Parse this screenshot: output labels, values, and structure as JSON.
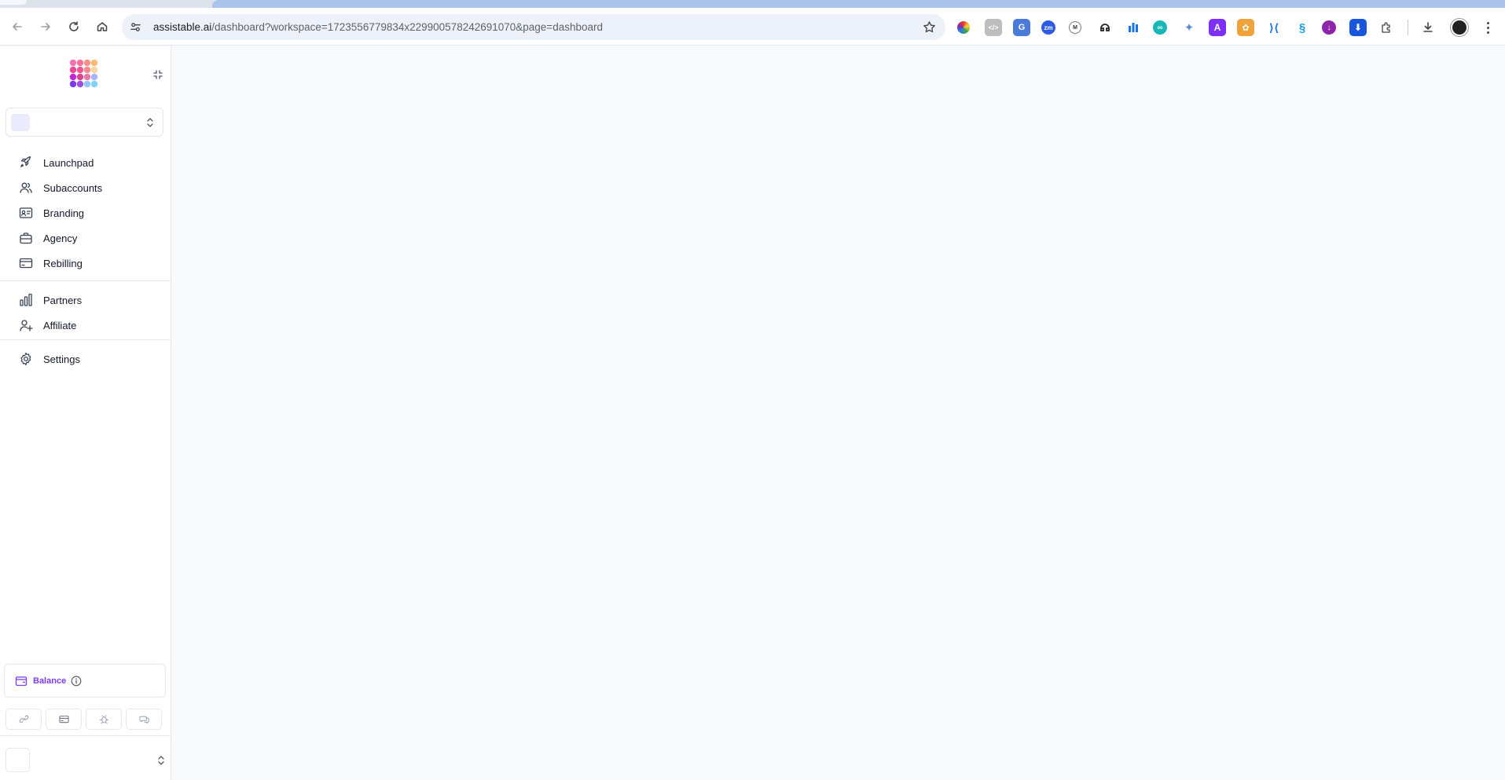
{
  "browser": {
    "url_host": "assistable.ai",
    "url_path": "/dashboard?workspace=1723556779834x229900578242691070&page=dashboard"
  },
  "sidebar": {
    "primary_items": [
      {
        "label": "Launchpad",
        "icon": "rocket-icon"
      },
      {
        "label": "Subaccounts",
        "icon": "users-icon"
      },
      {
        "label": "Branding",
        "icon": "id-card-icon"
      },
      {
        "label": "Agency",
        "icon": "briefcase-icon"
      },
      {
        "label": "Rebilling",
        "icon": "credit-card-icon"
      }
    ],
    "secondary_items": [
      {
        "label": "Partners",
        "icon": "bar-chart-icon"
      },
      {
        "label": "Affiliate",
        "icon": "user-plus-icon"
      }
    ],
    "settings_item": {
      "label": "Settings",
      "icon": "gear-icon"
    },
    "balance": {
      "label": "Balance"
    }
  },
  "colors": {
    "accent": "#7c3aed",
    "content_bg": "#f7f9fc",
    "workspace_swatch": "#eceafd"
  }
}
